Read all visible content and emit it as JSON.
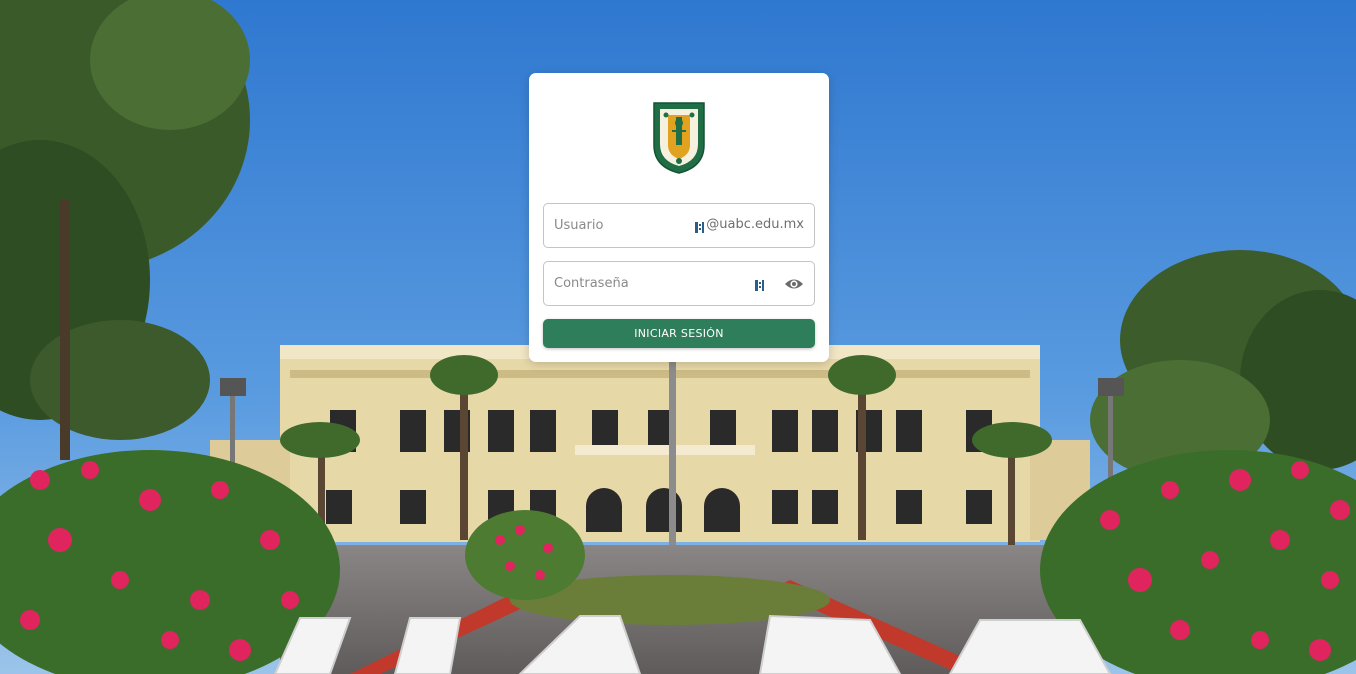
{
  "background": {
    "description_icon": "campus-building-photo",
    "sign_letters": "UABC"
  },
  "login": {
    "crest_icon": "university-crest-icon",
    "username": {
      "placeholder": "Usuario",
      "value": "",
      "domain_suffix": "@uabc.edu.mx"
    },
    "password": {
      "placeholder": "Contraseña",
      "value": "",
      "toggle_icon": "eye-icon"
    },
    "submit_label": "INICIAR SESIÓN",
    "password_manager_icon": "password-manager-icon"
  },
  "colors": {
    "primary": "#2e7d5b",
    "card": "#ffffff",
    "border": "#c4c4c4",
    "crest_green": "#1f6e45",
    "crest_gold": "#e0a21f"
  }
}
